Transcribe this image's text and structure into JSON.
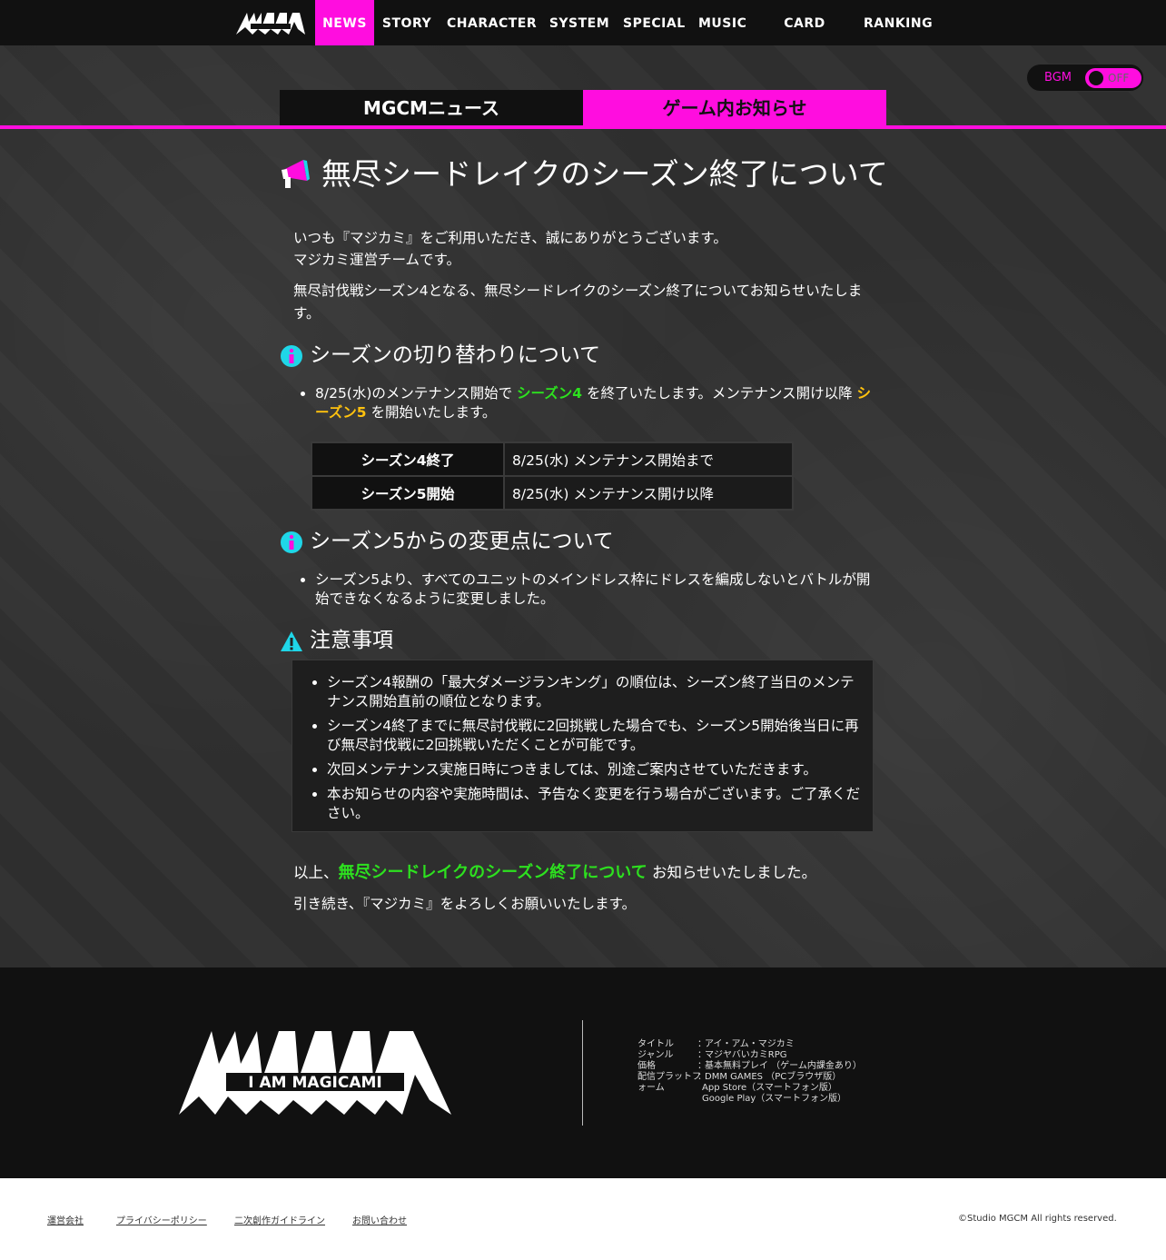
{
  "nav": {
    "items": [
      "NEWS",
      "STORY",
      "CHARACTER",
      "SYSTEM",
      "SPECIAL",
      "MUSIC",
      "CARD MAKER",
      "RANKING"
    ],
    "active": "NEWS"
  },
  "bgm": {
    "label": "BGM",
    "state": "OFF"
  },
  "tabs": [
    "MGCMニュース",
    "ゲーム内お知らせ"
  ],
  "article": {
    "title": "無尽シードレイクのシーズン終了について",
    "intro1": "いつも『マジカミ』をご利用いただき、誠にありがとうございます。",
    "intro2": "マジカミ運営チームです。",
    "intro3a": "無尽討伐戦シーズン4となる、無尽シードレイクのシーズン終了についてお知らせいたしま",
    "intro3b": "す。",
    "sec1": {
      "title": "シーズンの切り替わりについて",
      "b1_pre": "8/25(水)のメンテナンス開始で ",
      "b1_green": "シーズン4",
      "b1_mid": " を終了いたします。メンテナンス開け以降 ",
      "b1_yellow": "シーズン5",
      "b1_post": " を開始いたします。",
      "table": [
        {
          "h": "シーズン4終了",
          "v": "8/25(水) メンテナンス開始まで"
        },
        {
          "h": "シーズン5開始",
          "v": "8/25(水) メンテナンス開け以降"
        }
      ]
    },
    "sec2": {
      "title": "シーズン5からの変更点について",
      "b1": "シーズン5より、すべてのユニットのメインドレス枠にドレスを編成しないとバトルが開始できなくなるように変更しました。"
    },
    "sec3": {
      "title": "注意事項",
      "items": [
        "シーズン4報酬の「最大ダメージランキング」の順位は、シーズン終了当日のメンテナンス開始直前の順位となります。",
        "シーズン4終了までに無尽討伐戦に2回挑戦した場合でも、シーズン5開始後当日に再び無尽討伐戦に2回挑戦いただくことが可能です。",
        "次回メンテナンス実施日時につきましては、別途ご案内させていただきます。",
        "本お知らせの内容や実施時間は、予告なく変更を行う場合がございます。ご了承ください。"
      ]
    },
    "outro_pre": "以上、",
    "outro_green": "無尽シードレイクのシーズン終了について",
    "outro_post": " お知らせいたしました。",
    "outro2": "引き続き、『マジカミ』をよろしくお願いいたします。"
  },
  "footer": {
    "logo_text": "I AM MAGICAMI",
    "info": [
      {
        "k": "タイトル",
        "v": "アイ・アム・マジカミ"
      },
      {
        "k": "ジャンル",
        "v": "マジヤバいカミRPG"
      },
      {
        "k": "価格",
        "v": "基本無料プレイ （ゲーム内課金あり）"
      },
      {
        "k": "配信プラットフ",
        "v": "DMM GAMES （PCブラウザ版）"
      },
      {
        "k": "ォーム",
        "v": "App Store（スマートフォン版）"
      },
      {
        "k": "",
        "v": "Google Play（スマートフォン版）"
      }
    ],
    "links": [
      "運営会社",
      "プライバシーポリシー",
      "二次創作ガイドライン",
      "お問い合わせ"
    ],
    "copyright": "©Studio MGCM All rights reserved."
  },
  "colors": {
    "accent": "#ff0ddf",
    "green": "#2de11f",
    "yellow": "#ffc20e",
    "info_icon": "#1fd6e8"
  }
}
